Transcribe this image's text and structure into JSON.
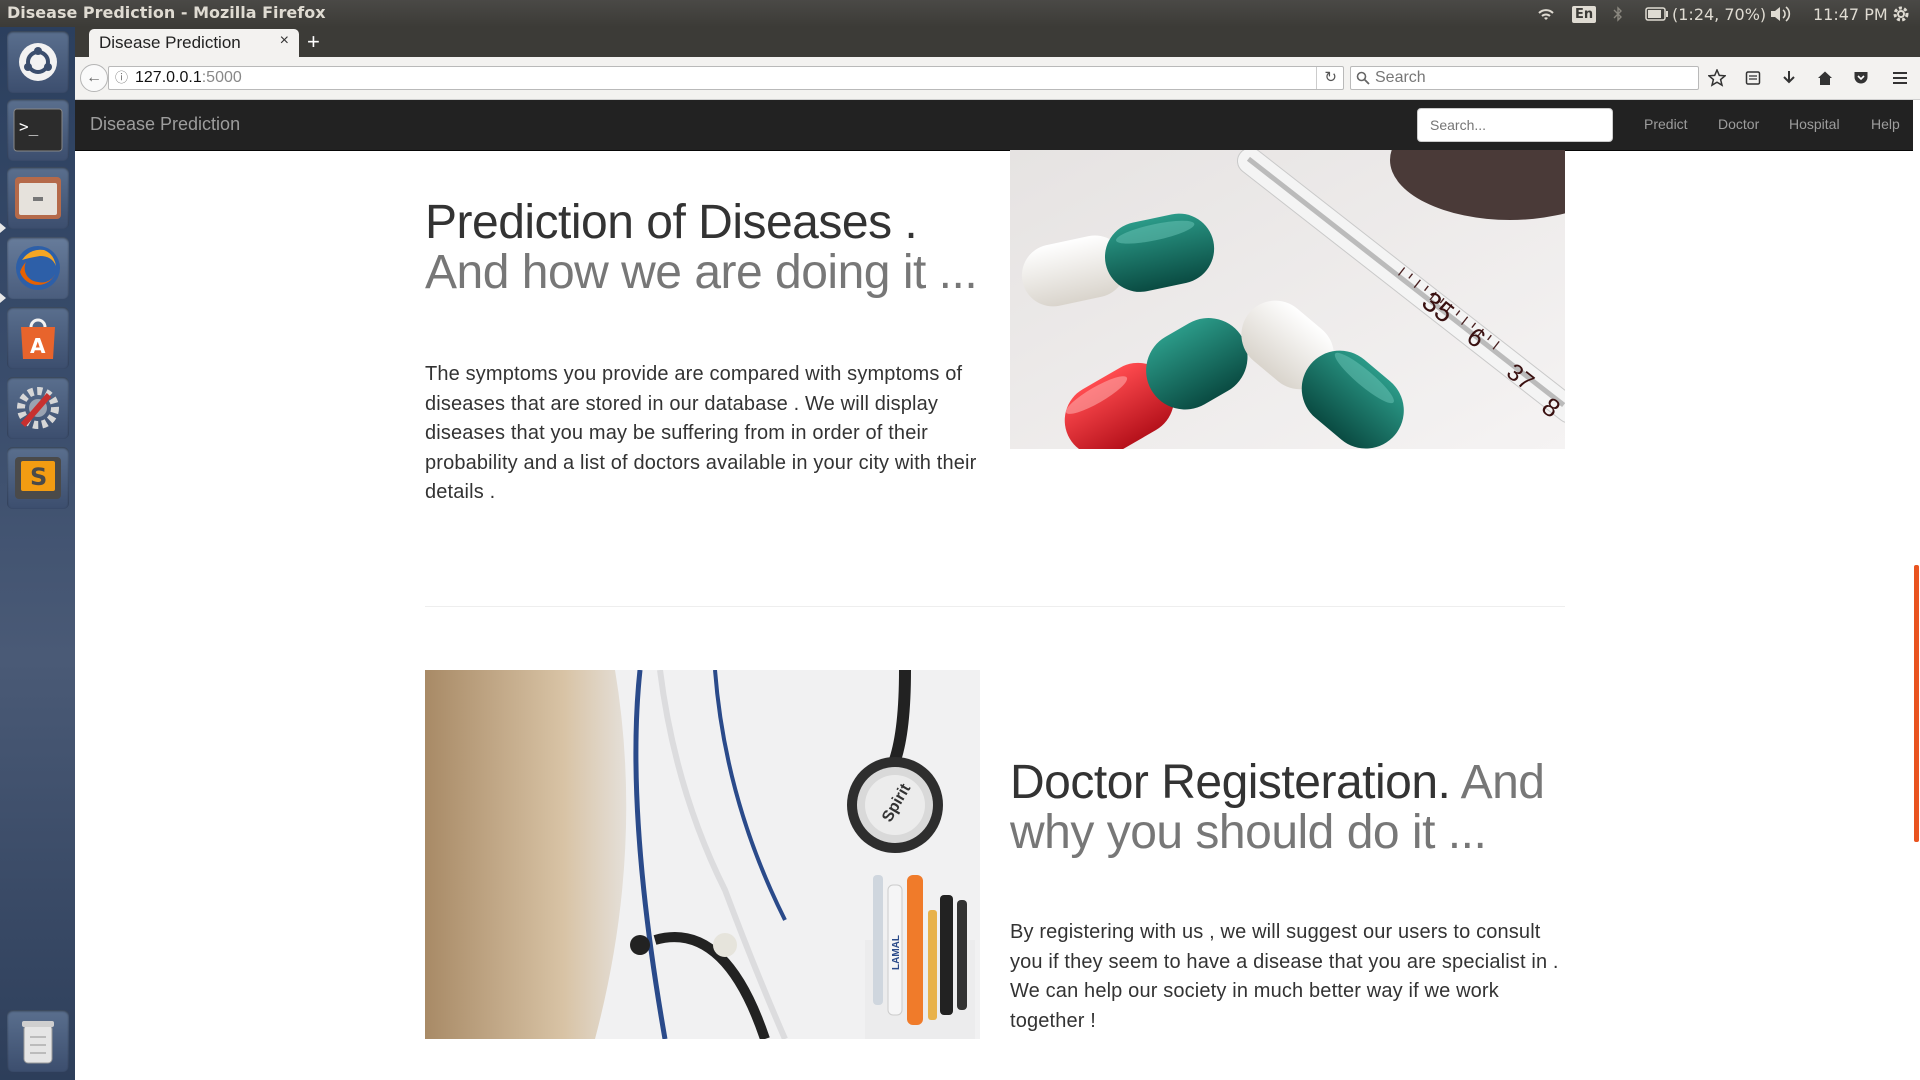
{
  "top_panel": {
    "window_title": "Disease Prediction - Mozilla Firefox",
    "keyboard_layout": "En",
    "battery_text": "(1:24, 70%)",
    "clock": "11:47 PM"
  },
  "launcher": {
    "items": [
      "ubuntu-dash",
      "terminal",
      "files",
      "firefox",
      "software-center",
      "system-settings",
      "sublime-text",
      "trash"
    ]
  },
  "browser": {
    "tab_title": "Disease Prediction",
    "tab_close": "×",
    "new_tab": "+",
    "url_host": "127.0.0.1",
    "url_port": ":5000",
    "search_placeholder": "Search"
  },
  "site": {
    "brand": "Disease Prediction",
    "search_placeholder": "Search...",
    "nav": [
      "Predict",
      "Doctor",
      "Hospital",
      "Help"
    ]
  },
  "feature1": {
    "heading": "Prediction of Diseases .",
    "heading_muted": "And how we are doing it ...",
    "text": "The symptoms you provide are compared with symptoms of diseases that are stored in our database . We will display diseases that you may be suffering from in order of their probability and a list of doctors available in your city with their details ."
  },
  "feature2": {
    "heading": "Doctor Registeration.",
    "heading_muted": "And why you should do it ...",
    "text": "By registering with us , we will suggest our users to consult you if they seem to have a disease that you are specialist in . We can help our society in much better way if we work together !"
  },
  "images": {
    "pills_thermometer": {
      "thermometer_labels": [
        "35",
        "6",
        "37",
        "8"
      ]
    },
    "doctor_coat": {
      "stethoscope_text": "Spirit",
      "pen_text": "LAMAL"
    }
  },
  "colors": {
    "navbar_bg": "#222222",
    "scroll_accent": "#e95420",
    "capsule_teal": "#0e6b5e",
    "capsule_red": "#d81f2a"
  }
}
